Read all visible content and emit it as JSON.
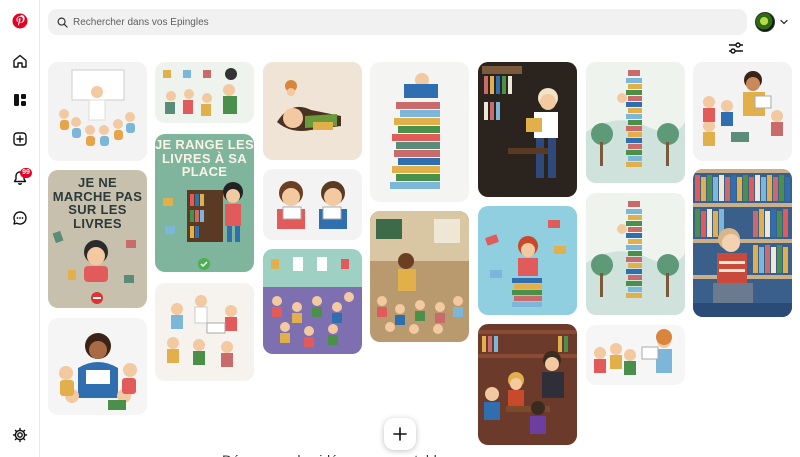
{
  "search": {
    "placeholder": "Rechercher dans vos Épingles"
  },
  "sidebar": {
    "items": [
      {
        "name": "pinterest-logo-icon",
        "color": "#e60023"
      },
      {
        "name": "home-icon"
      },
      {
        "name": "boards-icon"
      },
      {
        "name": "create-icon"
      },
      {
        "name": "notifications-icon"
      },
      {
        "name": "messages-icon"
      },
      {
        "name": "settings-icon"
      }
    ],
    "notification_badge": "99"
  },
  "pins": {
    "pin_2_text": "Je ne marche pas sur les livres",
    "pin_4_text": "Je range les livres à sa place"
  },
  "footer": {
    "partial_text": "Découvrez des idées pour vos tableaux"
  },
  "colors": {
    "brand": "#e60023",
    "search_bg": "#f1f1f1"
  }
}
